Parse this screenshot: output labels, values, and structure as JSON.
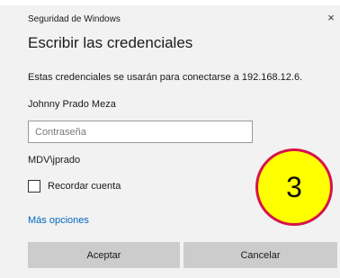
{
  "window": {
    "title": "Seguridad de Windows",
    "close_glyph": "×"
  },
  "heading": "Escribir las credenciales",
  "description": "Estas credenciales se usarán para conectarse a 192.168.12.6.",
  "account": {
    "display_name": "Johnny Prado Meza",
    "domain_user": "MDV\\jprado"
  },
  "password": {
    "placeholder": "Contraseña",
    "value": ""
  },
  "remember": {
    "label": "Recordar cuenta",
    "checked": false
  },
  "more_options": "Más opciones",
  "buttons": {
    "ok": "Aceptar",
    "cancel": "Cancelar"
  },
  "annotation": {
    "number": "3",
    "fill_color": "#ffff00",
    "border_color": "#d6134a"
  },
  "colors": {
    "link": "#0067c0",
    "dialog_bg": "#f2f2f2",
    "button_bg": "#cccccc"
  }
}
